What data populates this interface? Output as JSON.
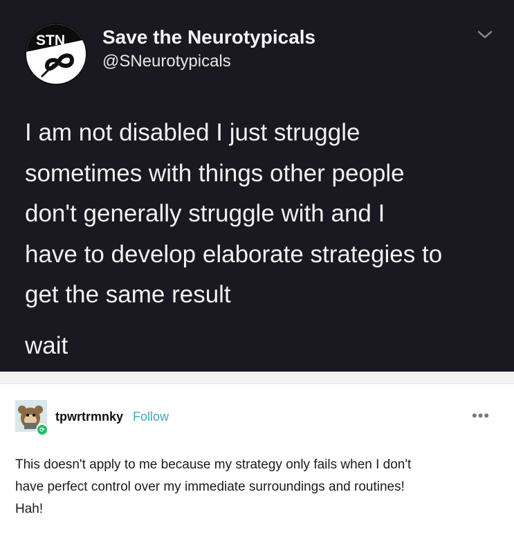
{
  "tweet": {
    "display_name": "Save the Neurotypicals",
    "handle": "@SNeurotypicals",
    "avatar_text": "STN",
    "avatar_icon": "infinity-with-slash-icon",
    "menu_icon": "chevron-down-icon",
    "body_lines": [
      "I am not disabled I just struggle",
      "sometimes with things other people",
      "don't generally struggle with and I",
      "have to develop elaborate strategies to",
      "get the same result"
    ],
    "punchline": "wait",
    "colors": {
      "background": "#1a1820",
      "text": "#f2f2f2"
    }
  },
  "reply": {
    "username": "tpwrtrmnky",
    "follow_label": "Follow",
    "more_icon": "ellipsis-icon",
    "more_label": "•••",
    "badge_icon": "reblog-badge-icon",
    "badge_label": "⟳",
    "text_lines": [
      "This doesn't apply to me because my strategy only fails when I don't",
      "have perfect control over my immediate surroundings and routines!",
      "Hah!"
    ],
    "colors": {
      "follow": "#3aa9c2",
      "badge": "#1fbd62"
    }
  }
}
